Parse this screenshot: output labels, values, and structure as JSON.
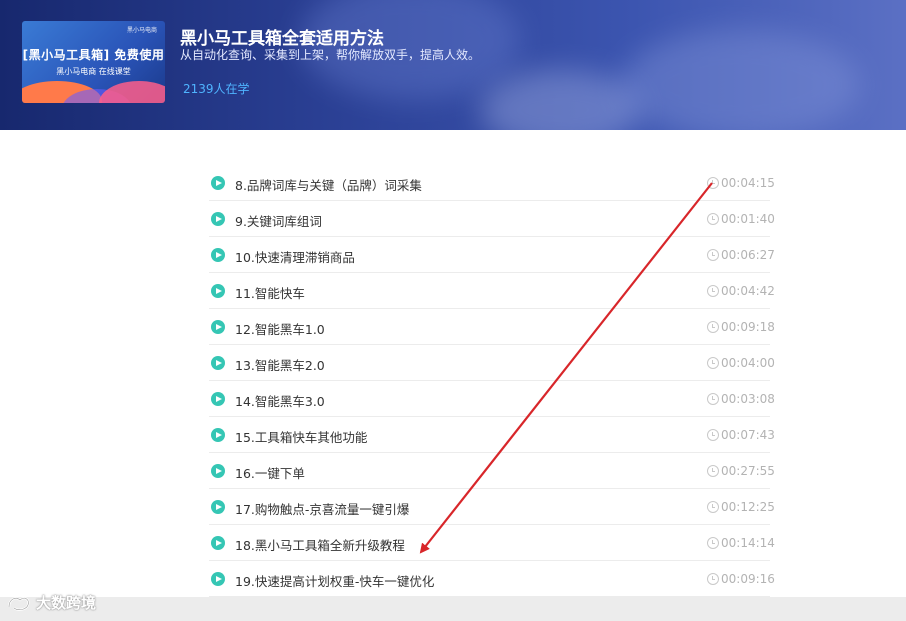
{
  "course": {
    "thumbnail": {
      "logo_text": "黑小马电商",
      "line1": "[黑小马工具箱] 免费使用",
      "line2": "黑小马电商  在线课堂"
    },
    "title": "黑小马工具箱全套适用方法",
    "subtitle": "从自动化查询、采集到上架，帮你解放双手，提高人效。",
    "learners": "2139人在学"
  },
  "lessons": [
    {
      "label": "8.品牌词库与关键（品牌）词采集",
      "duration": "00:04:15"
    },
    {
      "label": "9.关键词库组词",
      "duration": "00:01:40"
    },
    {
      "label": "10.快速清理滞销商品",
      "duration": "00:06:27"
    },
    {
      "label": "11.智能快车",
      "duration": "00:04:42"
    },
    {
      "label": "12.智能黑车1.0",
      "duration": "00:09:18"
    },
    {
      "label": "13.智能黑车2.0",
      "duration": "00:04:00"
    },
    {
      "label": "14.智能黑车3.0",
      "duration": "00:03:08"
    },
    {
      "label": "15.工具箱快车其他功能",
      "duration": "00:07:43"
    },
    {
      "label": "16.一键下单",
      "duration": "00:27:55"
    },
    {
      "label": "17.购物触点-京喜流量一键引爆",
      "duration": "00:12:25"
    },
    {
      "label": "18.黑小马工具箱全新升级教程",
      "duration": "00:14:14"
    },
    {
      "label": "19.快速提高计划权重-快车一键优化",
      "duration": "00:09:16"
    }
  ],
  "colors": {
    "play_icon": "#35c6b4",
    "arrow": "#d8262a",
    "learners_text": "#4fb4ff"
  },
  "watermark": {
    "text": "大数跨境"
  }
}
